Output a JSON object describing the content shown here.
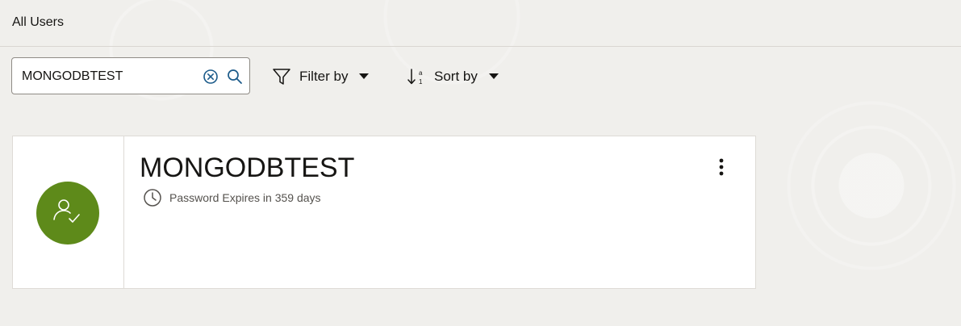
{
  "breadcrumb": {
    "label": "All Users"
  },
  "search": {
    "value": "MONGODBTEST",
    "clear_icon": "circle-x-icon",
    "search_icon": "magnifier-icon"
  },
  "toolbar": {
    "filter_label": "Filter by",
    "filter_icon": "funnel-icon",
    "sort_label": "Sort by",
    "sort_icon": "sort-arrows-icon"
  },
  "user_card": {
    "name": "MONGODBTEST",
    "status_text": "Password Expires in 359 days",
    "avatar_icon": "user-check-icon",
    "status_icon": "clock-icon",
    "actions_icon": "kebab-menu-icon"
  },
  "colors": {
    "background": "#f0efec",
    "avatar": "#5e8a1a",
    "card": "#ffffff"
  }
}
